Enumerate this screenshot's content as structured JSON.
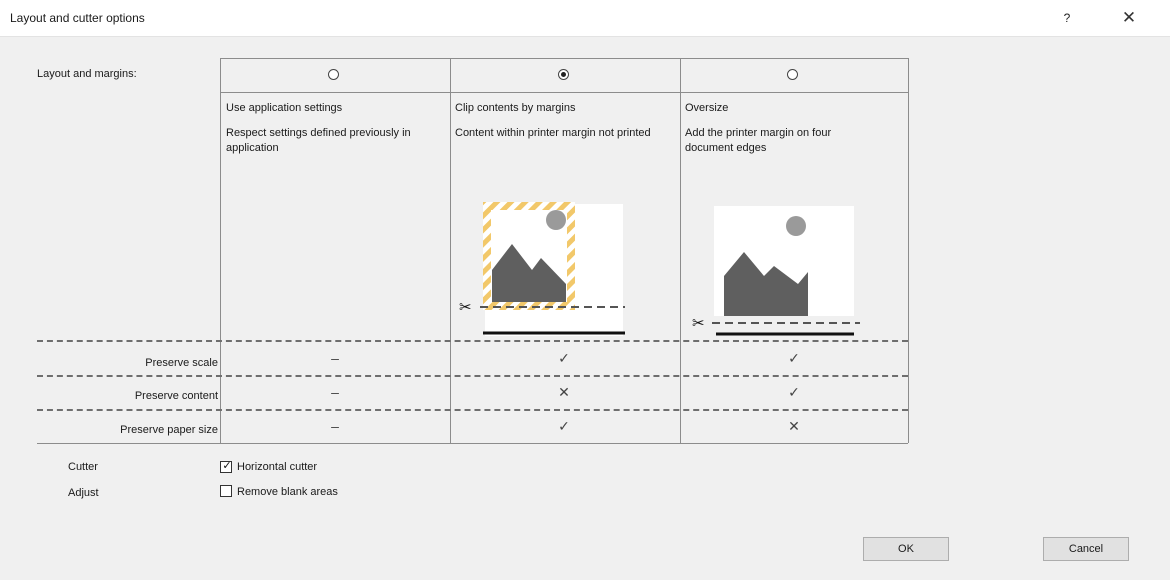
{
  "window": {
    "title": "Layout and cutter options",
    "help_label": "?",
    "close_label": "✕"
  },
  "layout_section": {
    "label": "Layout and margins:",
    "options": [
      {
        "name": "Use application settings",
        "description": "Respect settings defined previously in application",
        "selected": false
      },
      {
        "name": "Clip contents by margins",
        "description": "Content within printer margin not printed",
        "selected": true
      },
      {
        "name": "Oversize",
        "description": "Add the printer margin on four document edges",
        "selected": false
      }
    ]
  },
  "comparison": {
    "rows": [
      {
        "label": "Preserve scale",
        "values": [
          "–",
          "✓",
          "✓"
        ]
      },
      {
        "label": "Preserve content",
        "values": [
          "–",
          "✕",
          "✓"
        ]
      },
      {
        "label": "Preserve paper size",
        "values": [
          "–",
          "✓",
          "✕"
        ]
      }
    ]
  },
  "cutter": {
    "label": "Cutter",
    "checkbox_label": "Horizontal cutter",
    "checked": true
  },
  "adjust": {
    "label": "Adjust",
    "checkbox_label": "Remove blank areas",
    "checked": false
  },
  "buttons": {
    "ok": "OK",
    "cancel": "Cancel"
  },
  "icons": {
    "scissors_glyph": "✂",
    "checkbox_tick": "✓"
  },
  "colors": {
    "stripe_yellow": "#f2c86a",
    "illustration_gray": "#5f5f5f",
    "sun_gray": "#9a9a9a"
  }
}
